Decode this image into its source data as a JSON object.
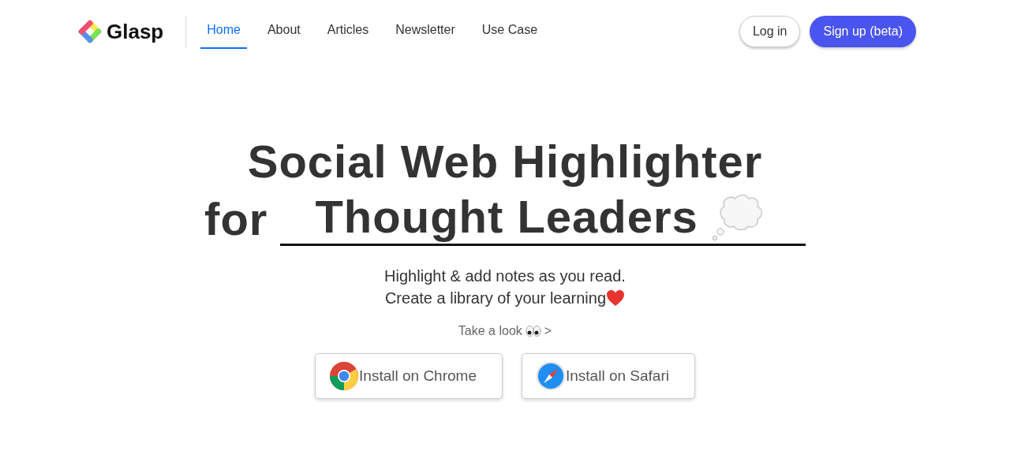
{
  "brand": {
    "name": "Glasp"
  },
  "nav": [
    {
      "label": "Home",
      "selected": true
    },
    {
      "label": "About",
      "selected": false
    },
    {
      "label": "Articles",
      "selected": false
    },
    {
      "label": "Newsletter",
      "selected": false
    },
    {
      "label": "Use Case",
      "selected": false
    }
  ],
  "auth": {
    "login": "Log in",
    "signup": "Sign up (beta)"
  },
  "hero": {
    "title_line1": "Social Web Highlighter",
    "title_prefix": "for",
    "title_highlight": "Thought Leaders",
    "subtitle": [
      "Highlight & add notes as you read.",
      "Create a library of your learning"
    ],
    "take_look": "Take a look",
    "take_look_arrow": ">"
  },
  "installs": [
    {
      "kind": "chrome",
      "label": "Install on Chrome"
    },
    {
      "kind": "safari",
      "label": "Install on Safari"
    }
  ]
}
